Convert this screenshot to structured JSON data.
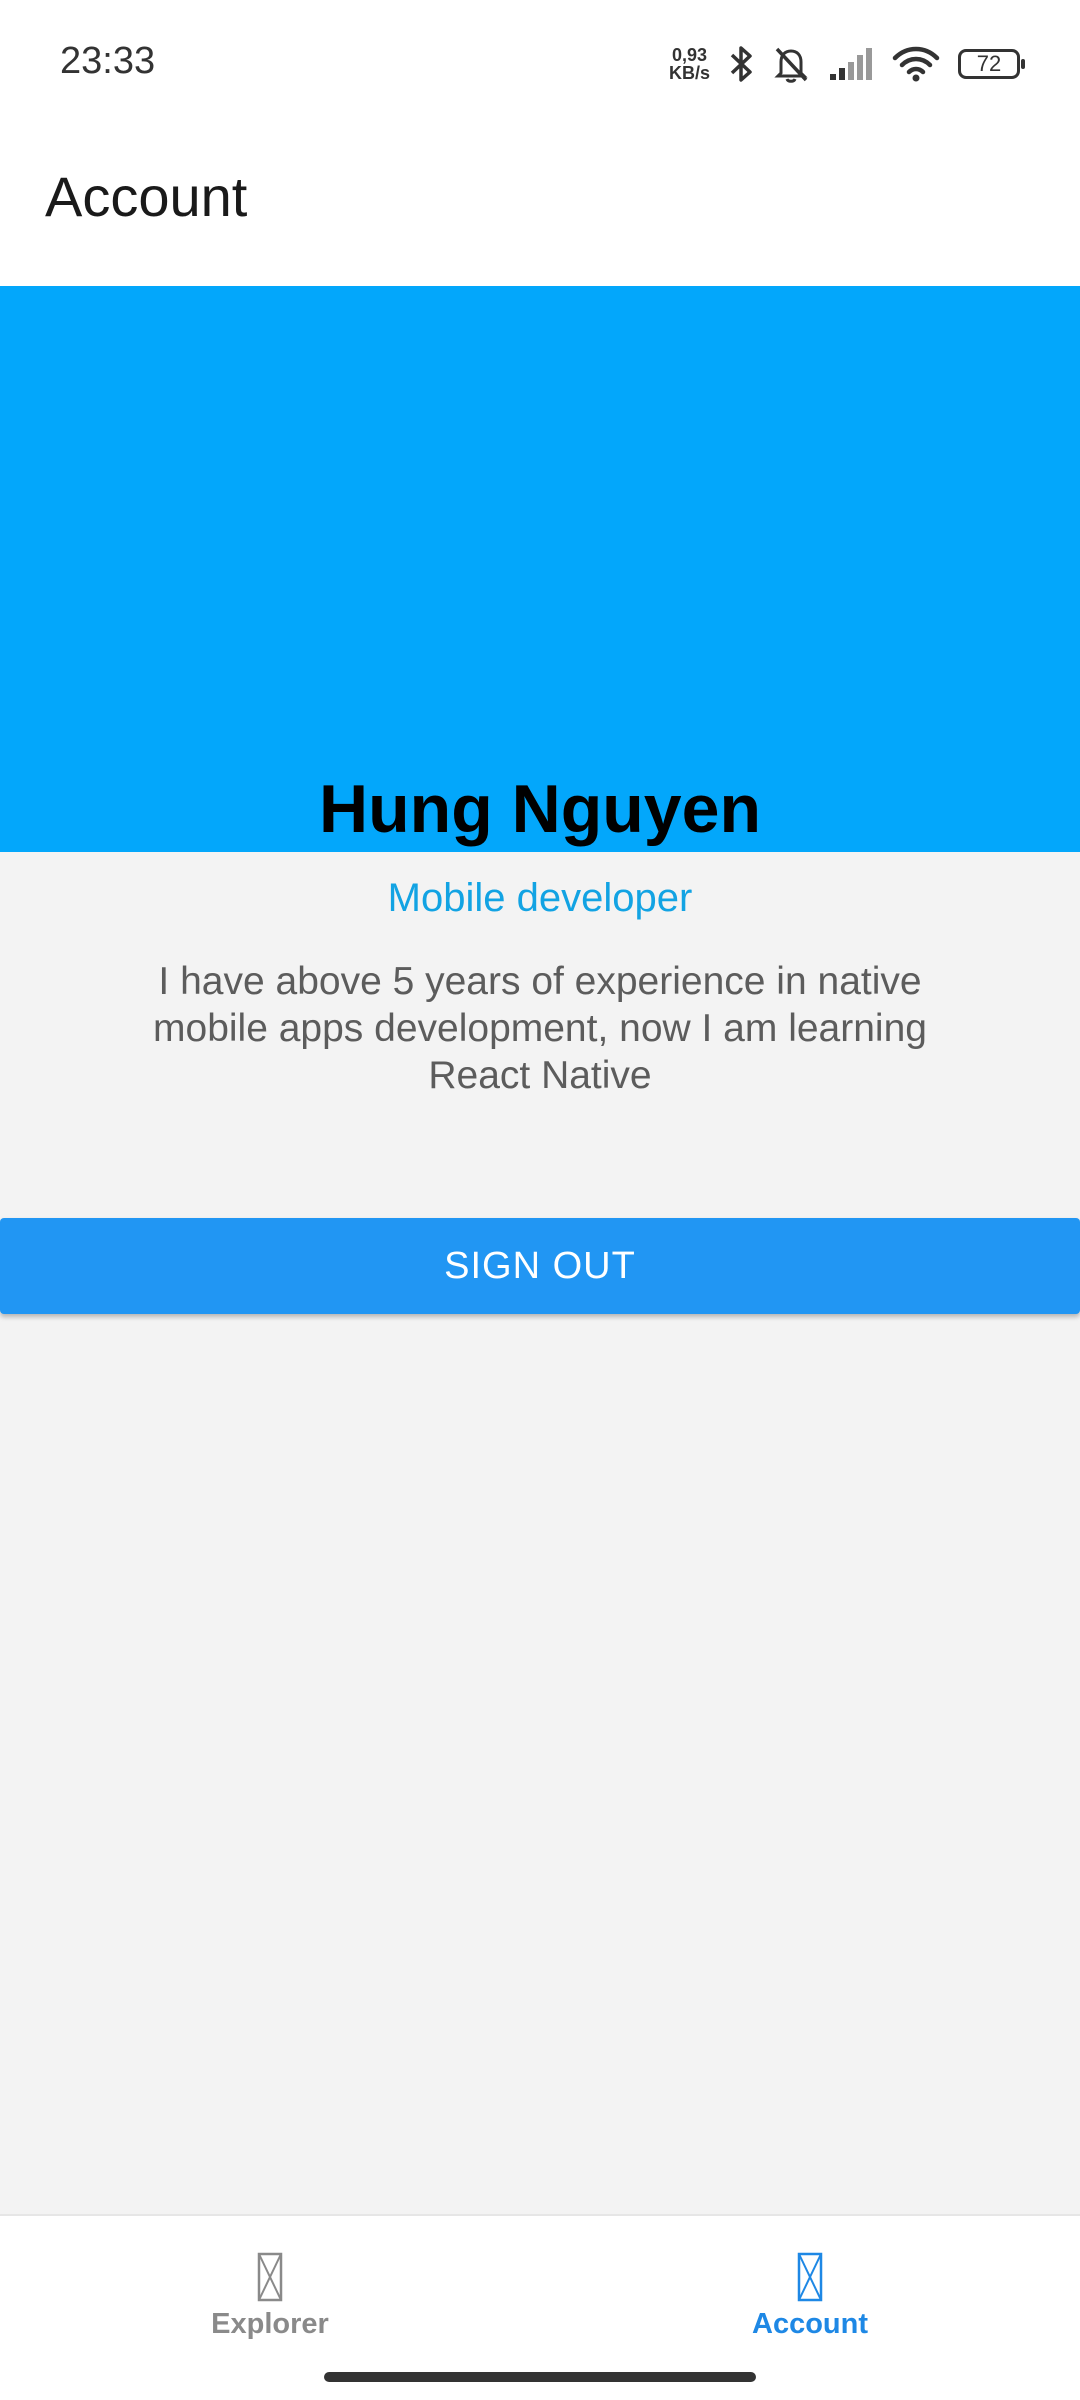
{
  "status_bar": {
    "time": "23:33",
    "net_speed_value": "0,93",
    "net_speed_unit": "KB/s",
    "battery": "72",
    "icons": [
      "bluetooth-icon",
      "bell-muted-icon",
      "cellular-signal-icon",
      "wifi-icon",
      "battery-icon"
    ]
  },
  "header": {
    "title": "Account"
  },
  "profile": {
    "name": "Hung Nguyen",
    "role": "Mobile developer",
    "bio": "I have above 5 years of experience in native mobile apps development, now I am learning React Native",
    "banner_color": "#03a7fb"
  },
  "actions": {
    "sign_out_label": "SIGN OUT",
    "button_color": "#2196f3"
  },
  "bottom_nav": {
    "items": [
      {
        "label": "Explorer",
        "icon": "placeholder-icon",
        "active": false
      },
      {
        "label": "Account",
        "icon": "placeholder-icon",
        "active": true
      }
    ],
    "active_color": "#1e88e5",
    "inactive_color": "#8a8a8a"
  }
}
